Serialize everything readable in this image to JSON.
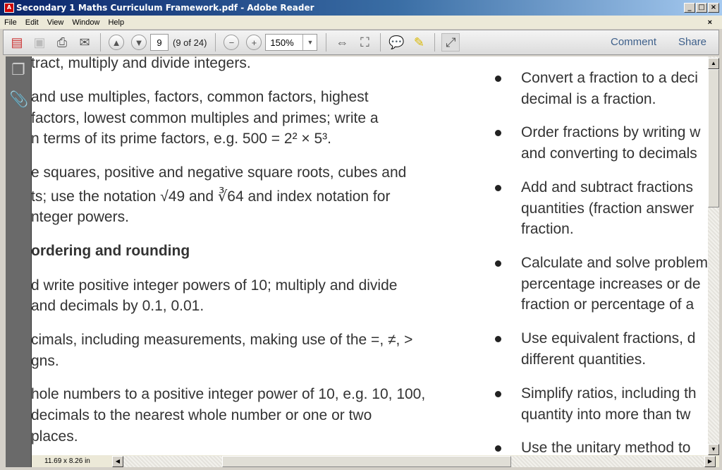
{
  "window": {
    "title": "Secondary 1 Maths Curriculum Framework.pdf - Adobe Reader",
    "buttons": [
      "_",
      "□",
      "×"
    ]
  },
  "menu": {
    "items": [
      "File",
      "Edit",
      "View",
      "Window",
      "Help"
    ],
    "close_doc": "×"
  },
  "toolbar": {
    "page_number": "9",
    "page_of": "(9 of 24)",
    "zoom": "150%",
    "comment": "Comment",
    "share": "Share",
    "icons": [
      "create-pdf-icon",
      "save-icon",
      "print-icon",
      "email-icon",
      "previous-page-icon",
      "next-page-icon",
      "zoom-out-icon",
      "zoom-in-icon",
      "fit-width-icon",
      "fit-page-icon",
      "sticky-note-icon",
      "highlight-text-icon",
      "full-screen-icon"
    ]
  },
  "sidebar": {
    "icons": [
      "pages-icon",
      "attachments-icon"
    ]
  },
  "document": {
    "left_lines": [
      {
        "text": "tract, multiply and divide integers.",
        "bold": false
      },
      {
        "text": "and use multiples, factors, common factors, highest",
        "bold": false
      },
      {
        "text": " factors, lowest common multiples and primes; write a",
        "bold": false
      },
      {
        "text": "n terms of its prime factors, e.g. 500 = 2² × 5³.",
        "bold": false
      },
      {
        "text": "e squares, positive and negative square roots, cubes and",
        "bold": false
      },
      {
        "text": "ts; use the notation √49  and ∛64  and index notation for",
        "bold": false
      },
      {
        "text": "nteger powers.",
        "bold": false
      },
      {
        "text": " ordering and rounding",
        "bold": true
      },
      {
        "text": "d write positive integer powers of 10; multiply and divide",
        "bold": false
      },
      {
        "text": " and decimals by 0.1, 0.01.",
        "bold": false
      },
      {
        "text": "cimals, including measurements, making use of the =, ≠, >",
        "bold": false
      },
      {
        "text": "gns.",
        "bold": false
      },
      {
        "text": "hole numbers to a positive integer power of 10, e.g. 10, 100,",
        "bold": false
      },
      {
        "text": "decimals to the nearest whole number or one or two",
        "bold": false
      },
      {
        "text": "places.",
        "bold": false
      }
    ],
    "right_items": [
      {
        "lines": [
          "Convert a fraction to a deci",
          "decimal is a fraction."
        ]
      },
      {
        "lines": [
          "Order fractions by writing w",
          "and converting to decimals"
        ]
      },
      {
        "lines": [
          "Add and subtract fractions",
          "quantities (fraction answer",
          "fraction."
        ]
      },
      {
        "lines": [
          "Calculate and solve problem",
          "percentage increases or de",
          "fraction or percentage of a"
        ]
      },
      {
        "lines": [
          "Use equivalent fractions, d",
          "different quantities."
        ]
      },
      {
        "lines": [
          "Simplify ratios, including th",
          "quantity into more than tw"
        ]
      },
      {
        "lines": [
          "Use the unitary method to"
        ]
      }
    ]
  },
  "status": {
    "page_size": "11.69 x 8.26 in"
  },
  "colors": {
    "link": "#3d5f8a",
    "sidebar": "#6a6a6a",
    "text": "#333333"
  }
}
